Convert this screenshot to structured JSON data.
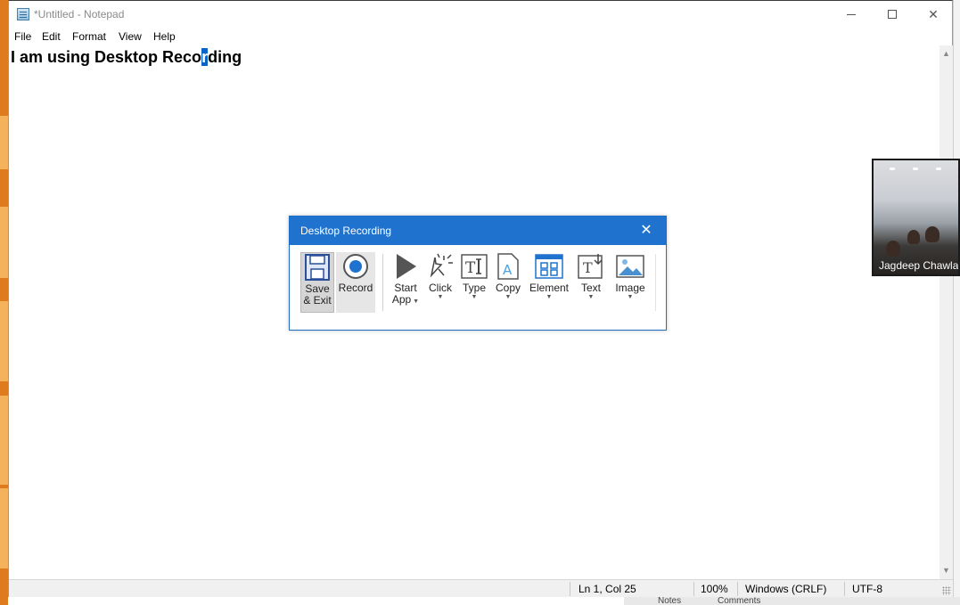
{
  "window": {
    "title": "*Untitled - Notepad",
    "controls": {
      "minimize": "—",
      "maximize": "☐",
      "close": "✕"
    }
  },
  "menu": [
    {
      "label": "File"
    },
    {
      "label": "Edit"
    },
    {
      "label": "Format"
    },
    {
      "label": "View"
    },
    {
      "label": "Help"
    }
  ],
  "editor": {
    "text_before": "I am using Desktop Reco",
    "text_selected": "r",
    "text_after": "ding"
  },
  "statusbar": {
    "position": "Ln 1, Col 25",
    "zoom": "100%",
    "line_ending": "Windows (CRLF)",
    "encoding": "UTF-8"
  },
  "dialog": {
    "title": "Desktop Recording",
    "close": "✕",
    "accent": "#1f73cf",
    "tools": {
      "save_exit": {
        "line1": "Save",
        "line2": "& Exit"
      },
      "record": {
        "label": "Record"
      },
      "start_app": {
        "line1": "Start",
        "line2": "App"
      },
      "click": {
        "label": "Click"
      },
      "type": {
        "label": "Type"
      },
      "copy": {
        "label": "Copy"
      },
      "element": {
        "label": "Element"
      },
      "text": {
        "label": "Text"
      },
      "image": {
        "label": "Image"
      }
    }
  },
  "video": {
    "participant_name": "Jagdeep Chawla"
  },
  "background": {
    "bottom_items": [
      "Notes",
      "Comments"
    ]
  }
}
